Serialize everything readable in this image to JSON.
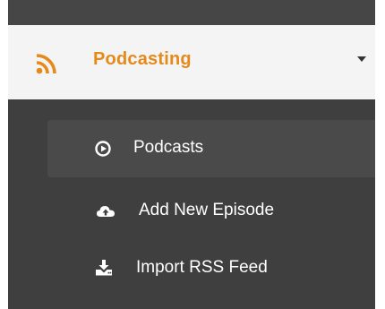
{
  "menu": {
    "section": {
      "title": "Podcasting",
      "icon": "rss-icon",
      "accent_color": "#e58a1a",
      "expanded": true
    },
    "items": [
      {
        "label": "Podcasts",
        "icon": "play-circle-icon",
        "active": true
      },
      {
        "label": "Add New Episode",
        "icon": "cloud-upload-icon",
        "active": false
      },
      {
        "label": "Import RSS Feed",
        "icon": "download-icon",
        "active": false
      }
    ]
  }
}
